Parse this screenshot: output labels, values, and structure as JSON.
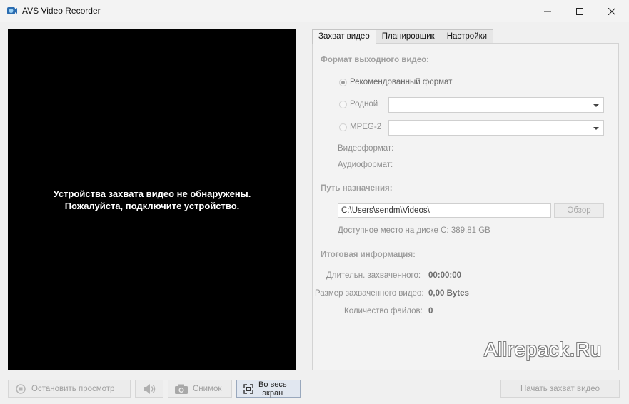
{
  "window": {
    "title": "AVS Video Recorder"
  },
  "preview": {
    "message_line1": "Устройства захвата видео не обнаружены.",
    "message_line2": "Пожалуйста, подключите устройство."
  },
  "tabs": [
    {
      "label": "Захват видео",
      "active": true
    },
    {
      "label": "Планировщик",
      "active": false
    },
    {
      "label": "Настройки",
      "active": false
    }
  ],
  "format": {
    "heading": "Формат выходного видео:",
    "recommended_label": "Рекомендованный формат",
    "native_label": "Родной",
    "native_value": "",
    "mpeg2_label": "MPEG-2",
    "mpeg2_value": "",
    "video_format_label": "Видеоформат:",
    "audio_format_label": "Аудиоформат:"
  },
  "destination": {
    "heading": "Путь назначения:",
    "path_value": "C:\\Users\\sendm\\Videos\\",
    "browse_label": "Обзор",
    "free_space": "Доступное место на диске C: 389,81 GB"
  },
  "summary": {
    "heading": "Итоговая информация:",
    "duration_label": "Длительн. захваченного:",
    "duration_value": "00:00:00",
    "size_label": "Размер захваченного видео:",
    "size_value": "0,00 Bytes",
    "files_label": "Количество файлов:",
    "files_value": "0"
  },
  "watermark": "Allrepack.Ru",
  "bottom": {
    "stop_preview": "Остановить просмотр",
    "snapshot": "Снимок",
    "fullscreen_line1": "Во весь",
    "fullscreen_line2": "экран",
    "start_capture": "Начать захват видео"
  },
  "colors": {
    "preview_bg": "#000000",
    "fullscreen_active_bg": "#e1e7f0",
    "disabled_text": "#a0a0a0"
  }
}
